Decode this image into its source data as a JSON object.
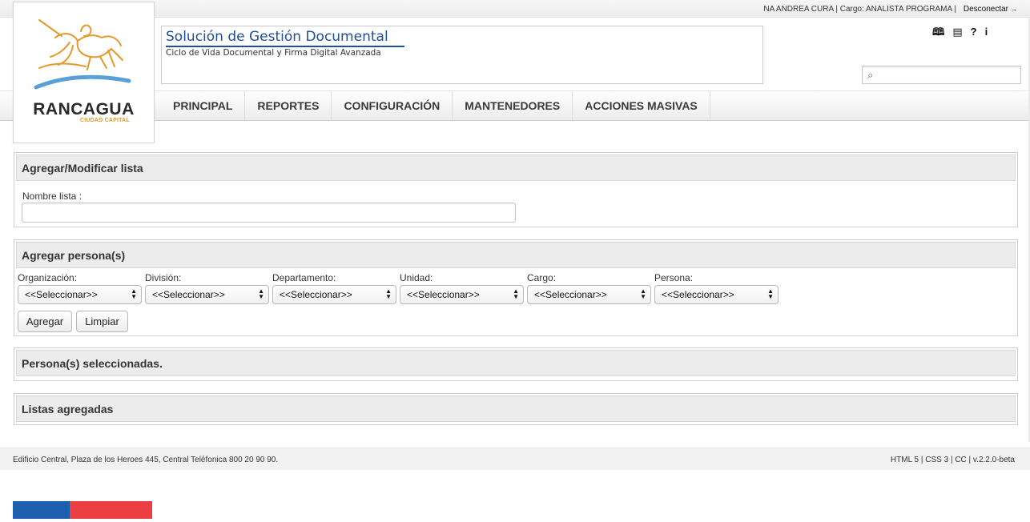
{
  "header": {
    "user_info": "NA ANDREA CURA | Cargo: ANALISTA PROGRAMA |",
    "logout_label": "Desconectar",
    "logout_icon": "logout-arrow-icon",
    "app_title": "Solución de Gestión Documental",
    "app_subtitle": "Ciclo de Vida Documental y Firma Digital Avanzada",
    "utility_icons": [
      "book-icon",
      "newspaper-icon",
      "help-icon",
      "info-icon"
    ],
    "search": {
      "placeholder": "",
      "icon": "search-icon"
    }
  },
  "logo": {
    "city": "RANCAGUA",
    "tagline": "CIUDAD CAPITAL",
    "colors": {
      "orange": "#e49a2a",
      "blue": "#5aa0d8"
    }
  },
  "nav": {
    "items": [
      "PRINCIPAL",
      "REPORTES",
      "CONFIGURACIÓN",
      "MANTENEDORES",
      "ACCIONES MASIVAS"
    ]
  },
  "list_panel": {
    "title": "Agregar/Modificar lista",
    "name_label": "Nombre lista :",
    "name_value": ""
  },
  "persons_panel": {
    "title": "Agregar persona(s)",
    "filters": [
      {
        "label": "Organización:",
        "value": "<<Seleccionar>>"
      },
      {
        "label": "División:",
        "value": "<<Seleccionar>>"
      },
      {
        "label": "Departamento:",
        "value": "<<Seleccionar>>"
      },
      {
        "label": "Unidad:",
        "value": "<<Seleccionar>>"
      },
      {
        "label": "Cargo:",
        "value": "<<Seleccionar>>"
      },
      {
        "label": "Persona:",
        "value": "<<Seleccionar>>"
      }
    ],
    "add_button": "Agregar",
    "clear_button": "Limpiar"
  },
  "selected_panel": {
    "title": "Persona(s) seleccionadas."
  },
  "lists_panel": {
    "title": "Listas agregadas"
  },
  "footer": {
    "address": "Edificio Central, Plaza de los Heroes 445, Central Teléfonica 800 20 90 90.",
    "tech": "HTML 5 | CSS 3 | CC | v.2.2.0-beta"
  },
  "colors": {
    "title_blue": "#1d4f9a",
    "flag_blue": "#1b5fae",
    "flag_red": "#ec3f43",
    "panel_header": "#ececec"
  }
}
